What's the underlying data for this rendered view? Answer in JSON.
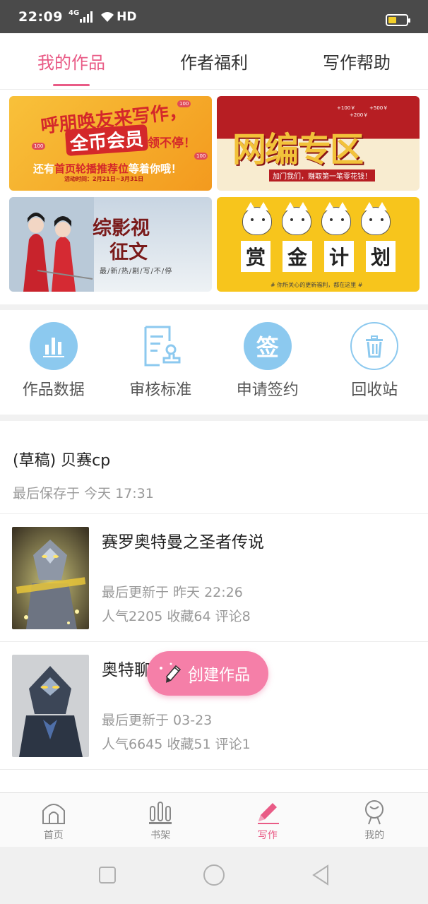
{
  "status_bar": {
    "time": "22:09",
    "network": "4G",
    "hd": "HD",
    "battery_level": 0.35,
    "battery_color": "#f2cf2a"
  },
  "tabs": [
    {
      "label": "我的作品",
      "active": true
    },
    {
      "label": "作者福利",
      "active": false
    },
    {
      "label": "写作帮助",
      "active": false
    }
  ],
  "banners": {
    "invite": {
      "line1": "呼朋唤友来写作，",
      "line2": "全币会员",
      "line2b": "领不停！",
      "line3_prefix": "还有",
      "line3_highlight": "首页轮播推荐位",
      "line3_suffix": "等着你哦！",
      "period": "活动时间：2月21日~3月31日",
      "tag": "100"
    },
    "editor": {
      "title": "网编专区",
      "subtitle": "加门我们，赚取第一笔零花钱！",
      "money": [
        "+100￥",
        "+500￥",
        "+200￥"
      ]
    },
    "drama": {
      "title_line1": "综影视",
      "title_line2": "征文",
      "tagline": "最/新/热/剧/写/不/停"
    },
    "bounty": {
      "words": [
        "赏",
        "金",
        "计",
        "划"
      ],
      "footer": "# 你所关心的更新福利，都在这里 #"
    }
  },
  "tools": [
    {
      "label": "作品数据",
      "icon": "bar-chart-icon"
    },
    {
      "label": "审核标准",
      "icon": "review-doc-icon"
    },
    {
      "label": "申请签约",
      "icon": "sign-icon",
      "glyph": "签"
    },
    {
      "label": "回收站",
      "icon": "trash-icon"
    }
  ],
  "draft": {
    "title": "(草稿) 贝赛cp",
    "saved": "最后保存于 今天 17:31"
  },
  "works": [
    {
      "title": "赛罗奥特曼之圣者传说",
      "updated": "最后更新于 昨天 22:26",
      "stats": "人气2205 收藏64 评论8"
    },
    {
      "title": "奥特聊",
      "updated": "最后更新于 03-23",
      "stats": "人气6645 收藏51 评论1"
    }
  ],
  "fab": {
    "label": "创建作品"
  },
  "bottom_nav": [
    {
      "label": "首页",
      "icon": "home-icon",
      "active": false
    },
    {
      "label": "书架",
      "icon": "bookshelf-icon",
      "active": false
    },
    {
      "label": "写作",
      "icon": "pencil-icon",
      "active": true
    },
    {
      "label": "我的",
      "icon": "profile-icon",
      "active": false
    }
  ],
  "colors": {
    "accent": "#e95b86",
    "fab": "#f57fa8",
    "tool_icon": "#8cc9ef",
    "status_bar": "#4a4a4a"
  }
}
